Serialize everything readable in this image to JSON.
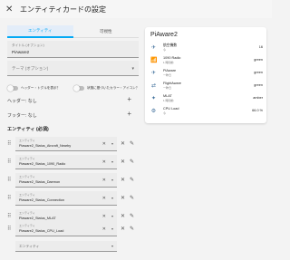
{
  "dialog": {
    "title": "エンティティカードの設定",
    "close_icon": "close-icon"
  },
  "tabs": [
    {
      "label": "エンティティ",
      "active": true
    },
    {
      "label": "可視性",
      "active": false
    }
  ],
  "editor": {
    "title_field": {
      "label": "タイトル (オプション)",
      "value": "PiAware2"
    },
    "theme_field": {
      "placeholder": "テーマ (オプション)"
    },
    "toggles": [
      {
        "label": "ヘッダー・トグルを表示？",
        "on": false
      },
      {
        "label": "状態に基づいたカラー・アイコン？",
        "on": false
      }
    ],
    "header": {
      "label": "ヘッダー: なし"
    },
    "footer": {
      "label": "フッター: なし"
    },
    "entities_title": "エンティティ (必須)",
    "entity_label": "エンティティ",
    "entities": [
      {
        "value": "Piaware2_Status_Aircraft_Nearby"
      },
      {
        "value": "Piaware2_Status_1090_Radio"
      },
      {
        "value": "Piaware2_Status_Daemon"
      },
      {
        "value": "Piaware2_Status_Connection"
      },
      {
        "value": "Piaware2_Status_MLAT"
      },
      {
        "value": "Piaware2_Status_CPU_Load"
      }
    ],
    "add_entity_placeholder": "エンティティ"
  },
  "preview": {
    "title": "PiAware2",
    "rows": [
      {
        "icon": "airplane-icon",
        "name": "航空機数",
        "sub": "今",
        "state": "16"
      },
      {
        "icon": "radio-icon",
        "name": "1090 Radio",
        "sub": "1 時間前",
        "state": "green"
      },
      {
        "icon": "airplane-icon",
        "name": "PiAware",
        "sub": "一昨日",
        "state": "green"
      },
      {
        "icon": "flight-icon",
        "name": "FlightAware",
        "sub": "一昨日",
        "state": "green"
      },
      {
        "icon": "mlat-icon",
        "name": "MLAT",
        "sub": "1 時間前",
        "state": "amber"
      },
      {
        "icon": "cpu-icon",
        "name": "CPU Load",
        "sub": "今",
        "state": "66.0 %"
      }
    ]
  },
  "colors": {
    "accent": "#03a9f4",
    "icon": "#44739e"
  }
}
